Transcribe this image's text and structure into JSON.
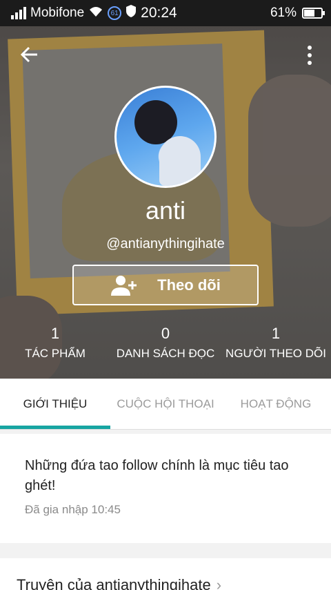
{
  "status_bar": {
    "carrier": "Mobifone",
    "badge": "61",
    "time": "20:24",
    "battery_percent": "61%",
    "battery_level": 0.61
  },
  "profile": {
    "username": "anti",
    "handle": "@antianythingihate",
    "follow_label": "Theo dõi"
  },
  "stats": [
    {
      "value": "1",
      "label": "TÁC PHẨM"
    },
    {
      "value": "0",
      "label": "DANH SÁCH ĐỌC"
    },
    {
      "value": "1",
      "label": "NGƯỜI THEO DÕI"
    }
  ],
  "tabs": [
    {
      "label": "GIỚI THIỆU",
      "active": true
    },
    {
      "label": "CUỘC HỘI THOẠI",
      "active": false
    },
    {
      "label": "HOẠT ĐỘNG",
      "active": false
    }
  ],
  "about": {
    "description": "Những đứa tao follow chính là mục tiêu tao ghét!",
    "joined": "Đã gia nhập 10:45"
  },
  "stories_heading": "Truyện của antianythingihate",
  "colors": {
    "accent": "#17a5a2",
    "status_bar": "#1b1b1b"
  },
  "icons": [
    "signal-icon",
    "wifi-icon",
    "shield-icon",
    "battery-icon",
    "back-arrow-icon",
    "more-vert-icon",
    "person-plus-icon",
    "chevron-right-icon"
  ]
}
